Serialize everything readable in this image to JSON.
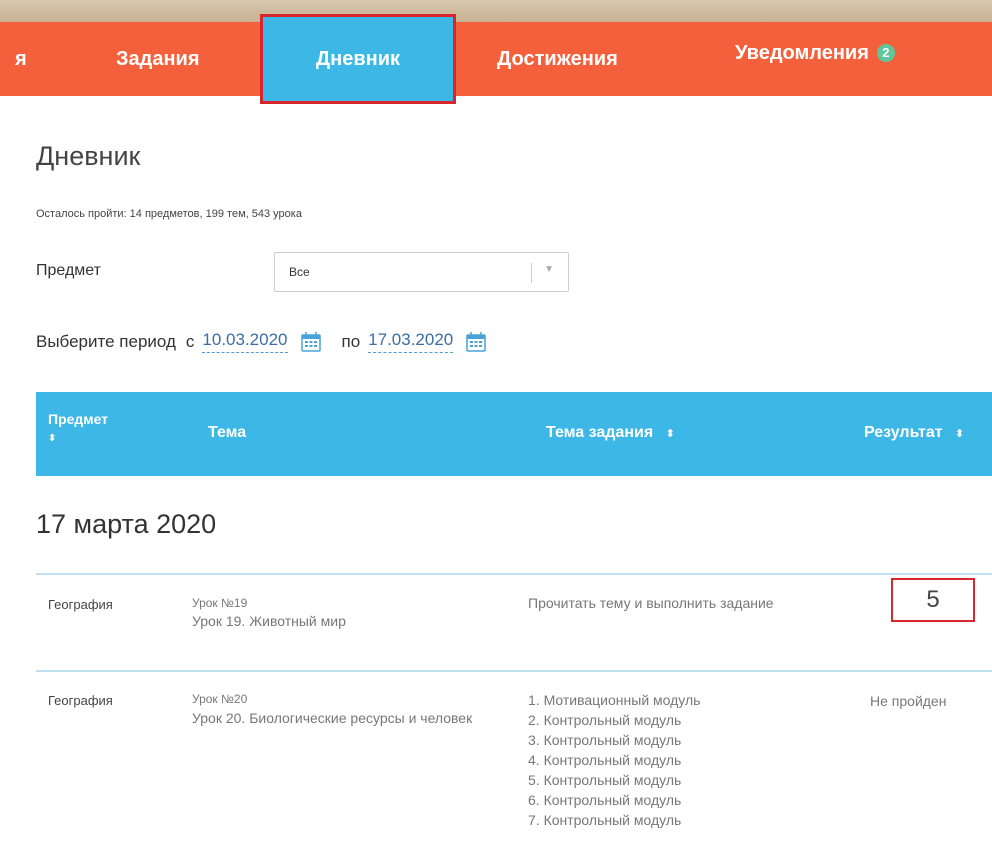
{
  "nav": {
    "partial_label": "я",
    "tasks_label": "Задания",
    "diary_label": "Дневник",
    "achievements_label": "Достижения",
    "notifications_label": "Уведомления",
    "notifications_count": "2"
  },
  "page": {
    "title": "Дневник",
    "remaining": "Осталось пройти: 14 предметов, 199 тем, 543 урока"
  },
  "filters": {
    "subject_label": "Предмет",
    "subject_value": "Все",
    "period_label": "Выберите период",
    "from_label": "с",
    "from_date": "10.03.2020",
    "to_label": "по",
    "to_date": "17.03.2020"
  },
  "table": {
    "headers": {
      "subject": "Предмет",
      "topic": "Тема",
      "task_topic": "Тема задания",
      "result": "Результат"
    },
    "sort_icon": "⬍"
  },
  "sections": [
    {
      "date": "17 марта 2020",
      "rows": [
        {
          "subject": "География",
          "lesson_no": "Урок №19",
          "lesson_title": "Урок 19. Животный мир",
          "task": "Прочитать тему и выполнить задание",
          "result": "5"
        },
        {
          "subject": "География",
          "lesson_no": "Урок №20",
          "lesson_title": "Урок 20. Биологические ресурсы и человек",
          "modules": [
            "1. Мотивационный модуль",
            "2. Контрольный модуль",
            "3. Контрольный модуль",
            "4. Контрольный модуль",
            "5. Контрольный модуль",
            "6. Контрольный модуль",
            "7. Контрольный модуль"
          ],
          "result": "Не пройден"
        }
      ]
    }
  ],
  "colors": {
    "nav_bg": "#f5603c",
    "active_tab": "#3db8e6",
    "highlight_border": "#d9262c",
    "badge": "#5fc69a"
  }
}
